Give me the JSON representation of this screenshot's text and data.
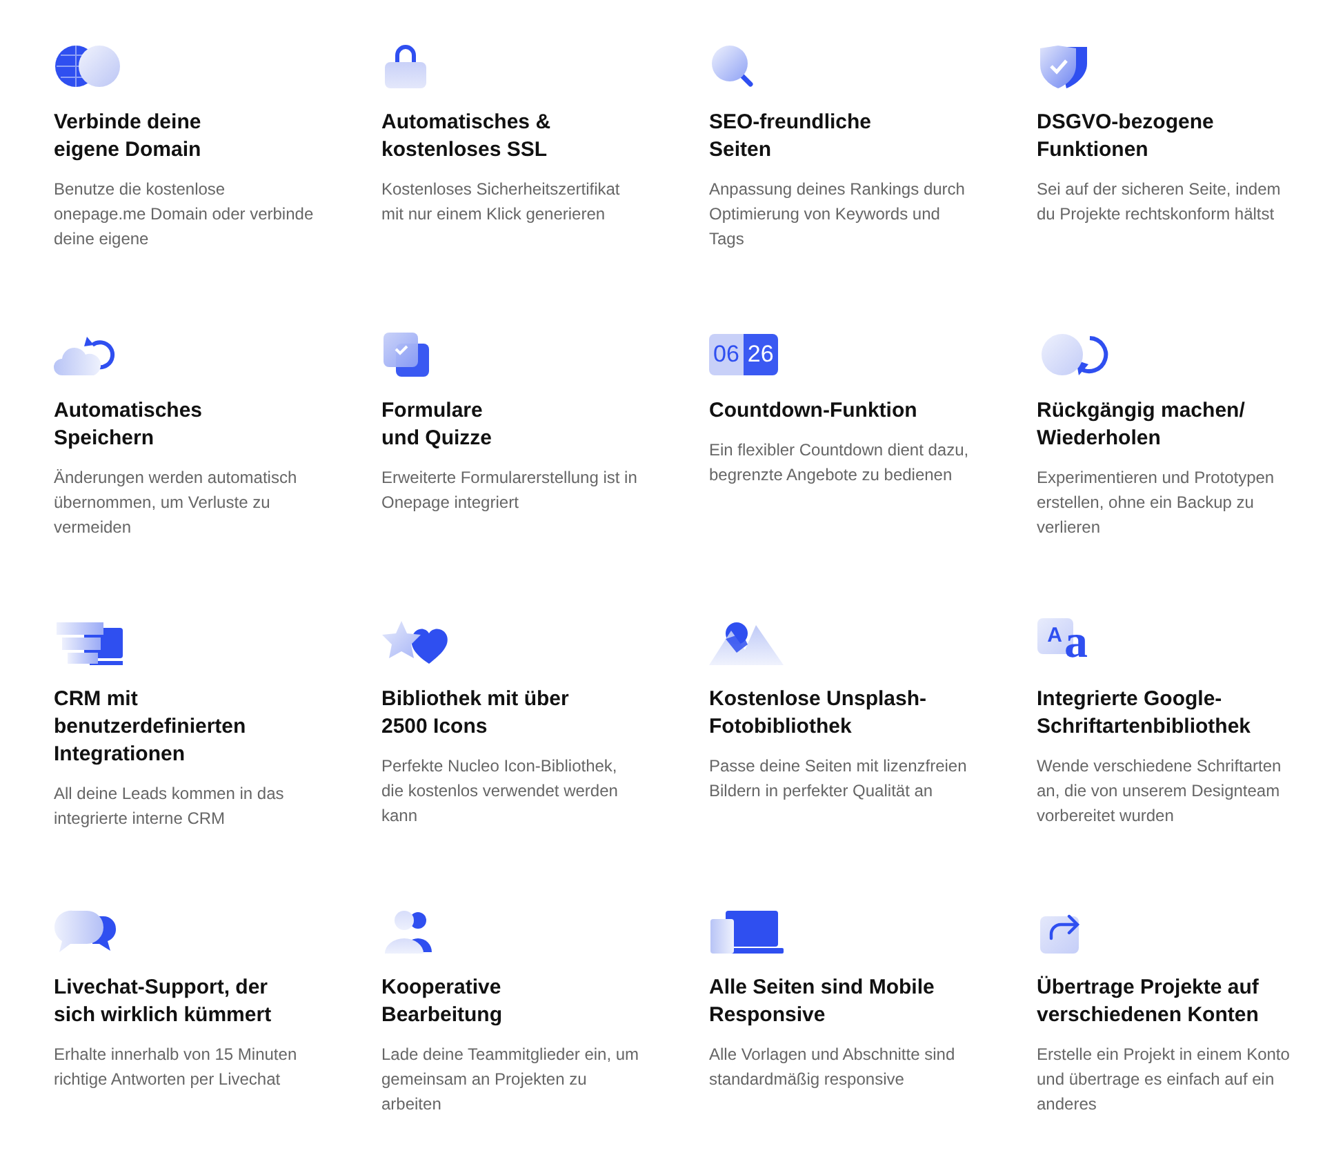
{
  "features": [
    {
      "kind": "globe",
      "title": "Verbinde deine\neigene Domain",
      "description": "Benutze die kostenlose\nonepage.me Domain oder verbinde\ndeine eigene"
    },
    {
      "kind": "lock",
      "title": "Automatisches &\nkostenloses SSL",
      "description": "Kostenloses Sicherheitszertifikat\nmit nur einem Klick generieren"
    },
    {
      "kind": "search",
      "title": "SEO-freundliche\nSeiten",
      "description": "Anpassung deines Rankings durch\nOptimierung von Keywords und\nTags"
    },
    {
      "kind": "shield",
      "title": "DSGVO-bezogene\nFunktionen",
      "description": "Sei auf der sicheren Seite, indem\ndu Projekte rechtskonform hältst"
    },
    {
      "kind": "cloud",
      "title": "Automatisches\nSpeichern",
      "description": "Änderungen werden automatisch\nübernommen, um Verluste zu\nvermeiden"
    },
    {
      "kind": "forms",
      "title": "Formulare\nund Quizze",
      "description": "Erweiterte Formularerstellung ist in\nOnepage integriert"
    },
    {
      "kind": "countdown",
      "icon_texts": [
        "06",
        "26"
      ],
      "title": "Countdown-Funktion",
      "description": "Ein flexibler Countdown dient dazu,\nbegrenzte Angebote zu bedienen"
    },
    {
      "kind": "undo",
      "title": "Rückgängig machen/\nWiederholen",
      "description": "Experimentieren und Prototypen\nerstellen, ohne ein Backup zu\nverlieren"
    },
    {
      "kind": "crm",
      "title": "CRM mit\nbenutzerdefinierten\nIntegrationen",
      "description": "All deine Leads kommen in das\nintegrierte interne CRM"
    },
    {
      "kind": "shapes",
      "title": "Bibliothek mit über\n2500 Icons",
      "description": "Perfekte Nucleo Icon-Bibliothek,\ndie kostenlos verwendet werden\nkann"
    },
    {
      "kind": "mountains",
      "title": "Kostenlose Unsplash-\nFotobibliothek",
      "description": "Passe deine Seiten mit lizenzfreien\nBildern in perfekter Qualität an"
    },
    {
      "kind": "fonts",
      "icon_texts": [
        "A",
        "a"
      ],
      "title": "Integrierte Google-\nSchriftartenbibliothek",
      "description": "Wende verschiedene Schriftarten\nan, die von unserem Designteam\nvorbereitet wurden"
    },
    {
      "kind": "chat",
      "title": "Livechat-Support, der\nsich wirklich kümmert",
      "description": "Erhalte innerhalb von 15 Minuten\nrichtige Antworten per Livechat"
    },
    {
      "kind": "team",
      "title": "Kooperative\nBearbeitung",
      "description": "Lade deine Teammitglieder ein, um\ngemeinsam an Projekten zu\narbeiten"
    },
    {
      "kind": "devices",
      "title": "Alle Seiten sind Mobile\nResponsive",
      "description": "Alle Vorlagen und Abschnitte sind\nstandardmäßig responsive"
    },
    {
      "kind": "share",
      "title": "Übertrage Projekte auf\nverschiedenen Konten",
      "description": "Erstelle ein Projekt in einem Konto\nund übertrage es einfach auf ein\nanderes"
    }
  ]
}
